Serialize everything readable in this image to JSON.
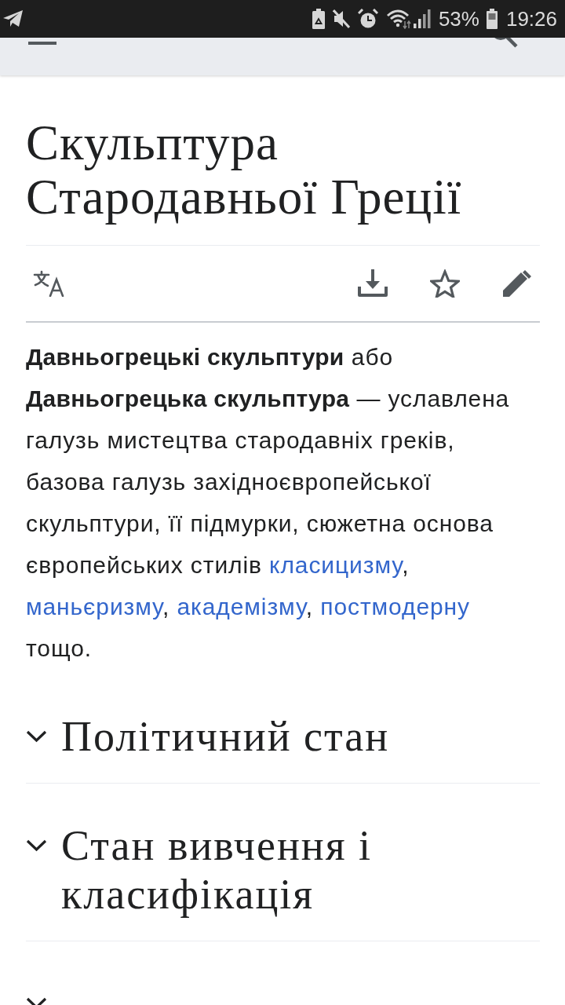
{
  "status_bar": {
    "battery": "53%",
    "time": "19:26"
  },
  "article": {
    "title": "Скульптура Стародавньої Греції",
    "intro": [
      {
        "kind": "text",
        "text": "**Давньогрецькі скульптури** або **Давньогрецька скульптура** — уславлена галузь мистецтва стародавніх греків, базова галузь західноєвропейської скульптури, її підмурки, сюжетна основа європейських стилів "
      },
      {
        "kind": "link",
        "text": "класицизму"
      },
      {
        "kind": "text",
        "text": ", "
      },
      {
        "kind": "link",
        "text": "маньєризму"
      },
      {
        "kind": "text",
        "text": ", "
      },
      {
        "kind": "link",
        "text": "академізму"
      },
      {
        "kind": "text",
        "text": ", "
      },
      {
        "kind": "link",
        "text": "постмодерну"
      },
      {
        "kind": "text",
        "text": " тощо."
      }
    ]
  },
  "sections": [
    {
      "heading": "Політичний стан",
      "expanded": false
    },
    {
      "heading": "Стан вивчення і класифікація",
      "expanded": false
    },
    {
      "expanded": false
    }
  ]
}
